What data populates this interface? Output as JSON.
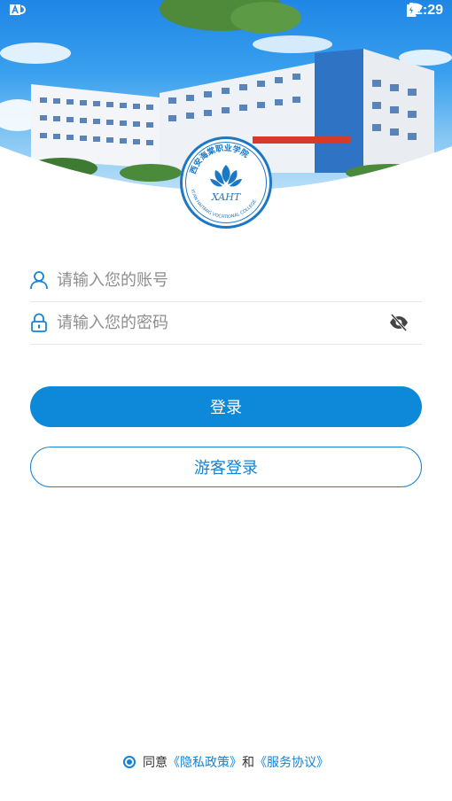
{
  "status_bar": {
    "time": "22:29"
  },
  "logo": {
    "name_text": "西安海棠职业学院",
    "english_text": "XI'AN HAITANG VOCATIONAL COLLEGE",
    "monogram": "XAHT"
  },
  "form": {
    "account_placeholder": "请输入您的账号",
    "password_placeholder": "请输入您的密码"
  },
  "buttons": {
    "login_label": "登录",
    "guest_login_label": "游客登录"
  },
  "agreement": {
    "prefix": "同意",
    "privacy_link": "《隐私政策》",
    "and_text": "和",
    "service_link": "《服务协议》"
  },
  "colors": {
    "accent": "#0e88d8",
    "link": "#1583d3"
  }
}
